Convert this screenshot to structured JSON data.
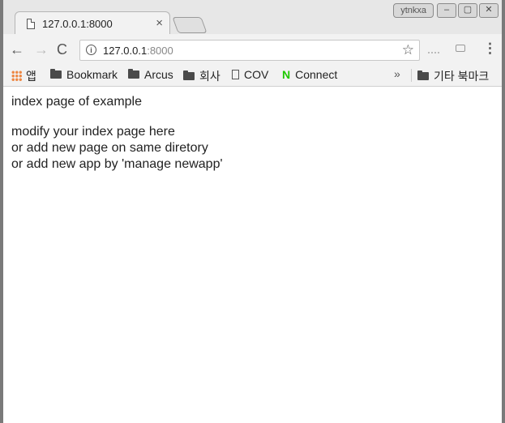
{
  "tab": {
    "title": "127.0.0.1:8000",
    "close": "×"
  },
  "window": {
    "user_badge": "ytnkxa",
    "min": "–",
    "max": "▢",
    "close": "✕"
  },
  "toolbar": {
    "back": "←",
    "forward": "→",
    "reload": "C",
    "info": "i",
    "url_host": "127.0.0.1",
    "url_port": ":8000",
    "star": "☆",
    "menu": "⋮"
  },
  "bookmarks": {
    "apps": "앱",
    "items": [
      "Bookmark",
      "Arcus",
      "회사",
      "COV",
      "Connect"
    ],
    "overflow": "»",
    "other": "기타 북마크"
  },
  "page": {
    "line1": "index page of example",
    "line2": "modify your index page here",
    "line3": "or add new page on same diretory",
    "line4": "or add new app by 'manage newapp'"
  }
}
